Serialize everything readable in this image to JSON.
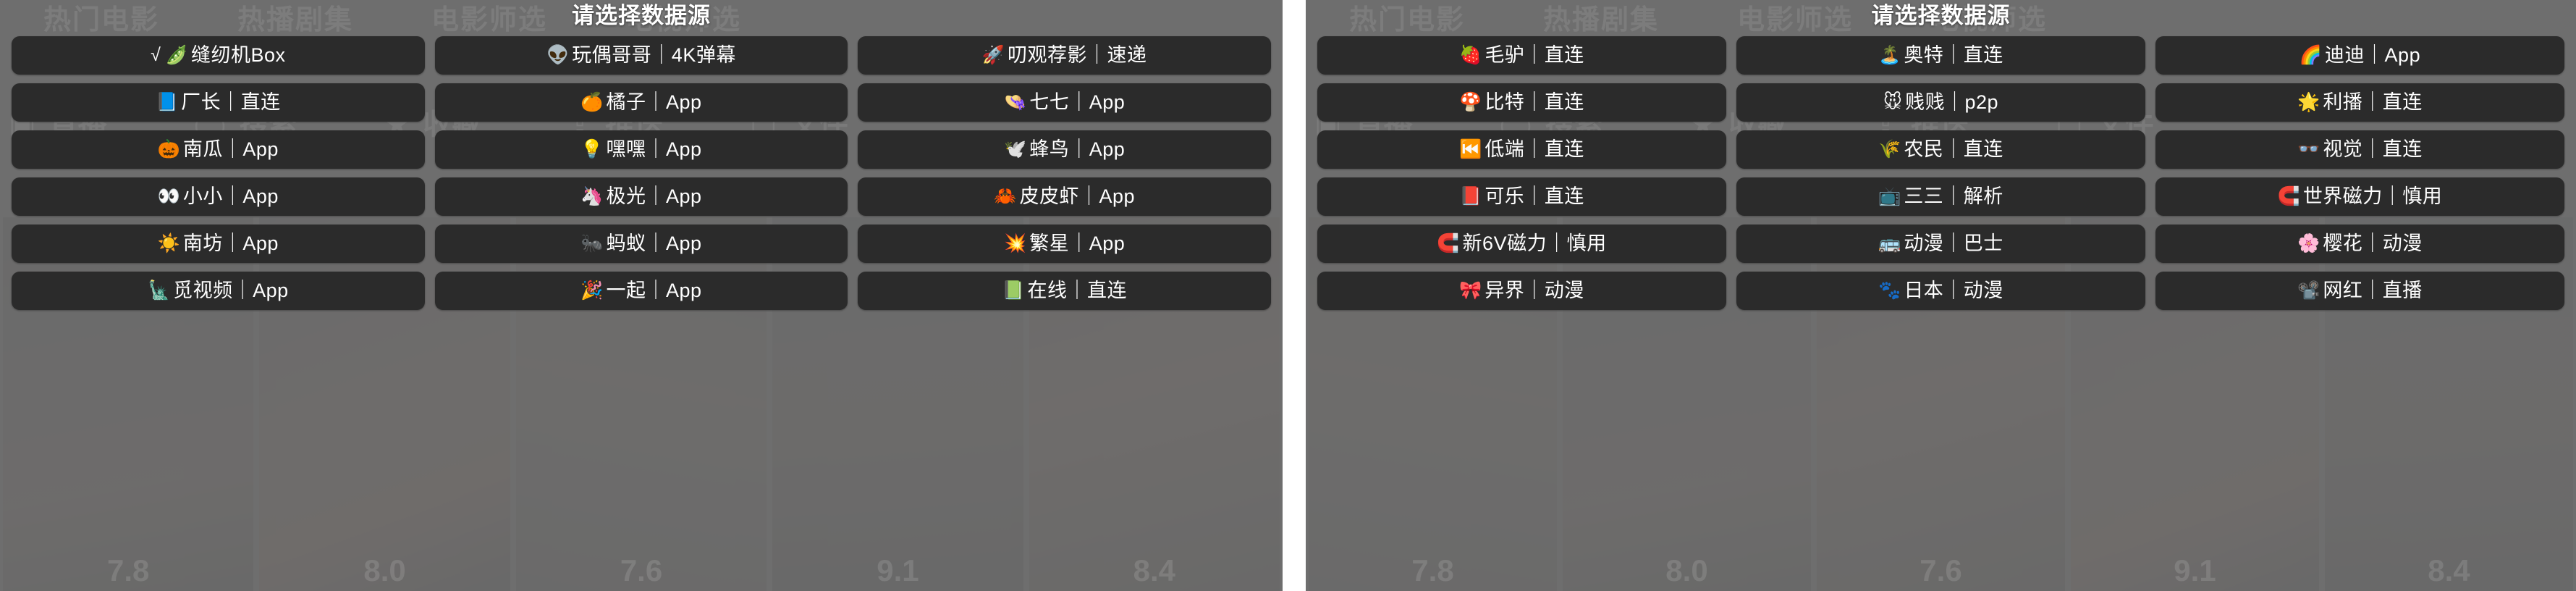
{
  "dialog_title": "请选择数据源",
  "background": {
    "nav_items": [
      "热门电影",
      "热播剧集",
      "电影师选",
      "电视师选"
    ],
    "icon_row": [
      {
        "glyph": "▣",
        "label": "直播"
      },
      {
        "glyph": "◯",
        "label": "搜索"
      },
      {
        "glyph": "★",
        "label": "收藏"
      },
      {
        "glyph": "⇪",
        "label": "推送"
      },
      {
        "glyph": "▢",
        "label": "文件"
      }
    ],
    "ratings": [
      "7.8",
      "8.0",
      "7.6",
      "9.1",
      "8.4"
    ]
  },
  "panels": [
    {
      "id": "left-panel",
      "title": "请选择数据源",
      "items": [
        {
          "emoji": "√ 🫛",
          "label": "缝纫机Box"
        },
        {
          "emoji": "👽",
          "label": "玩偶哥哥｜4K弹幕"
        },
        {
          "emoji": "🚀",
          "label": "叨观荐影｜速递"
        },
        {
          "emoji": "📘",
          "label": "厂长｜直连"
        },
        {
          "emoji": "🍊",
          "label": "橘子｜App"
        },
        {
          "emoji": "👒",
          "label": "七七｜App"
        },
        {
          "emoji": "🎃",
          "label": "南瓜｜App"
        },
        {
          "emoji": "💡",
          "label": "嘿嘿｜App"
        },
        {
          "emoji": "🕊️",
          "label": "蜂鸟｜App"
        },
        {
          "emoji": "👀",
          "label": "小小｜App"
        },
        {
          "emoji": "🦄",
          "label": "极光｜App"
        },
        {
          "emoji": "🦀",
          "label": "皮皮虾｜App"
        },
        {
          "emoji": "☀️",
          "label": "南坊｜App"
        },
        {
          "emoji": "🐜",
          "label": "蚂蚁｜App"
        },
        {
          "emoji": "💥",
          "label": "繁星｜App"
        },
        {
          "emoji": "🗽",
          "label": "觅视频｜App"
        },
        {
          "emoji": "🎉",
          "label": "一起｜App"
        },
        {
          "emoji": "📗",
          "label": "在线｜直连"
        }
      ]
    },
    {
      "id": "right-panel",
      "title": "请选择数据源",
      "items": [
        {
          "emoji": "🍓",
          "label": "毛驴｜直连"
        },
        {
          "emoji": "🏝️",
          "label": "奥特｜直连"
        },
        {
          "emoji": "🌈",
          "label": "迪迪｜App"
        },
        {
          "emoji": "🍄",
          "label": "比特｜直连"
        },
        {
          "emoji": "🐭",
          "label": "贱贱｜p2p"
        },
        {
          "emoji": "🌟",
          "label": "利播｜直连"
        },
        {
          "emoji": "⏮️",
          "label": "低端｜直连"
        },
        {
          "emoji": "🌾",
          "label": "农民｜直连"
        },
        {
          "emoji": "👓",
          "label": "视觉｜直连"
        },
        {
          "emoji": "📕",
          "label": "可乐｜直连"
        },
        {
          "emoji": "📺",
          "label": "三三｜解析"
        },
        {
          "emoji": "🧲",
          "label": "世界磁力｜慎用"
        },
        {
          "emoji": "🧲",
          "label": "新6V磁力｜慎用"
        },
        {
          "emoji": "🚌",
          "label": "动漫｜巴士"
        },
        {
          "emoji": "🌸",
          "label": "樱花｜动漫"
        },
        {
          "emoji": "🎀",
          "label": "异界｜动漫"
        },
        {
          "emoji": "🐾",
          "label": "日本｜动漫"
        },
        {
          "emoji": "📽️",
          "label": "网红｜直播"
        }
      ]
    }
  ]
}
